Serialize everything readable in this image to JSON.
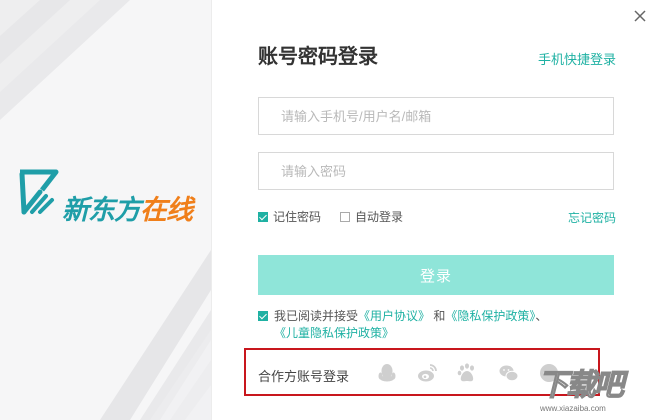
{
  "brand": {
    "logo_text_a": "新东方",
    "logo_text_b": "在线",
    "color_teal": "#1f9ea8",
    "color_orange": "#f07f1a"
  },
  "login": {
    "title": "账号密码登录",
    "quick_login_link": "手机快捷登录",
    "account_placeholder": "请输入手机号/用户名/邮箱",
    "account_value": "",
    "password_placeholder": "请输入密码",
    "password_value": "",
    "remember_label": "记住密码",
    "remember_checked": true,
    "auto_login_label": "自动登录",
    "auto_login_checked": false,
    "forgot_link": "忘记密码",
    "login_button": "登录",
    "agree_prefix": "我已阅读并接受",
    "agree_link_1": "《用户协议》",
    "agree_and": "和",
    "agree_link_2": "《隐私保护政策》",
    "agree_sep": "、",
    "agree_link_3": "《儿童隐私保护政策》",
    "agree_checked": true
  },
  "partners": {
    "label": "合作方账号登录",
    "icons": [
      "qq-icon",
      "weibo-icon",
      "baidu-icon",
      "wechat-icon",
      "more-icon"
    ]
  },
  "watermark": {
    "big": "下载吧",
    "small": "www.xiazaiba.com"
  },
  "colors": {
    "accent": "#1fb1a3",
    "button": "#8fe5d9",
    "highlight_box": "#c8161d"
  }
}
